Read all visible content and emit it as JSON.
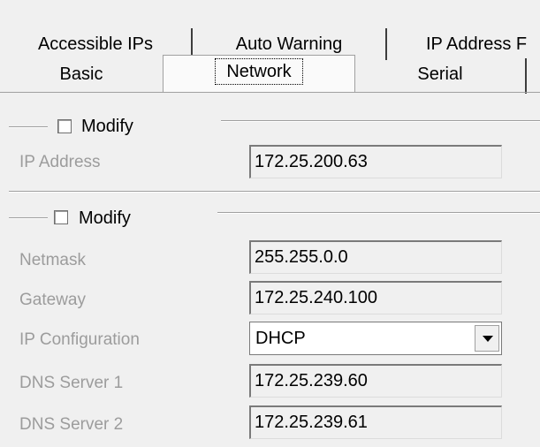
{
  "tabs": {
    "row1": [
      "Accessible IPs",
      "Auto Warning",
      "IP Address F"
    ],
    "row2": [
      "Basic",
      "Network",
      "Serial"
    ],
    "selected": "Network"
  },
  "group1": {
    "modify_label": "Modify",
    "modify_checked": false,
    "fields": [
      {
        "label": "IP Address",
        "value": "172.25.200.63"
      }
    ]
  },
  "group2": {
    "modify_label": "Modify",
    "modify_checked": false,
    "netmask": {
      "label": "Netmask",
      "value": "255.255.0.0"
    },
    "gateway": {
      "label": "Gateway",
      "value": "172.25.240.100"
    },
    "ip_config": {
      "label": "IP Configuration",
      "value": "DHCP"
    },
    "dns1": {
      "label": "DNS Server 1",
      "value": "172.25.239.60"
    },
    "dns2": {
      "label": "DNS Server 2",
      "value": "172.25.239.61"
    }
  }
}
